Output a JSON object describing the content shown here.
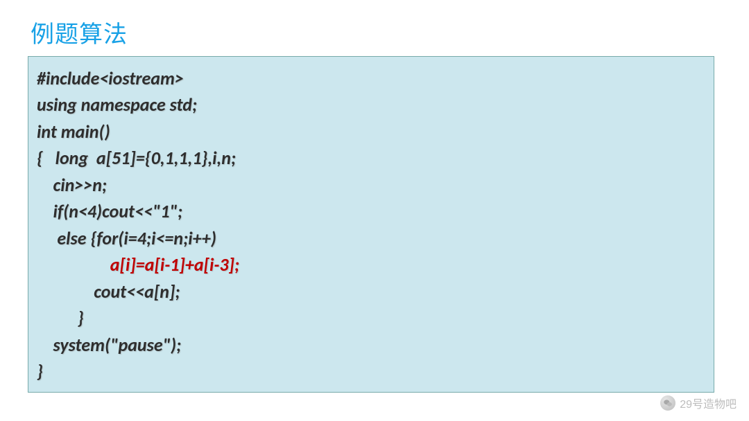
{
  "title": "例题算法",
  "code": {
    "lines": [
      {
        "text": "#include<iostream>",
        "red": false
      },
      {
        "text": "using namespace std;",
        "red": false
      },
      {
        "text": "int main()",
        "red": false
      },
      {
        "text": "{   long  a[51]={0,1,1,1},i,n;",
        "red": false
      },
      {
        "text": "    cin>>n;",
        "red": false
      },
      {
        "text": "    if(n<4)cout<<\"1\";",
        "red": false
      },
      {
        "text": "     else {for(i=4;i<=n;i++)",
        "red": false
      },
      {
        "text": "                  a[i]=a[i-1]+a[i-3];",
        "red": true
      },
      {
        "text": "              cout<<a[n];",
        "red": false
      },
      {
        "text": "          }",
        "red": false
      },
      {
        "text": "    system(\"pause\");",
        "red": false
      },
      {
        "text": "}",
        "red": false
      }
    ]
  },
  "watermark": {
    "text": "29号造物吧",
    "icon": "wechat-icon"
  },
  "colors": {
    "title": "#18a1e6",
    "code_bg": "#cce7ee",
    "code_text": "#2e2e2e",
    "highlight": "#c00000",
    "watermark": "#bdbdbd"
  }
}
